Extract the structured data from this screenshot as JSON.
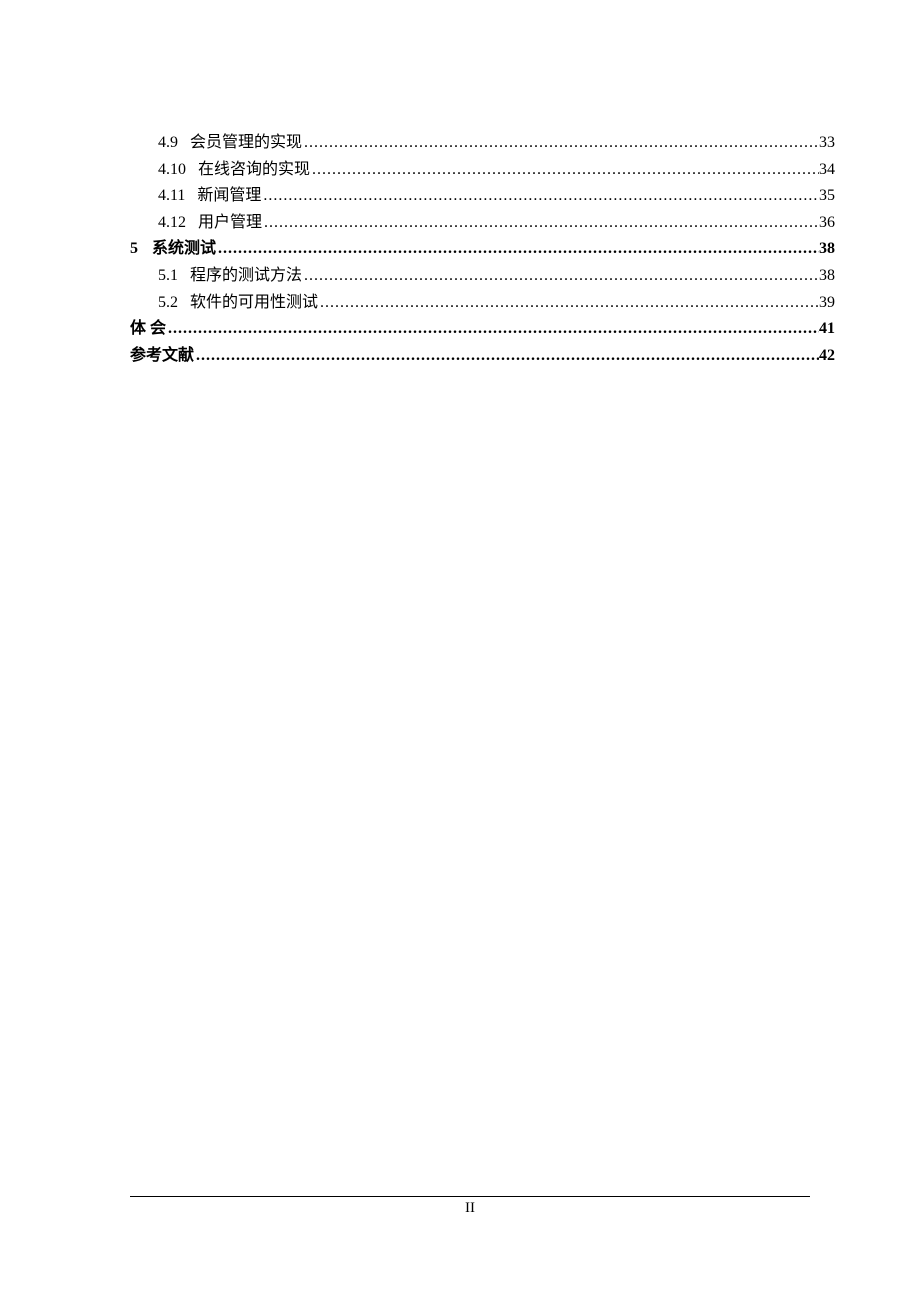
{
  "toc": {
    "items": [
      {
        "num": "4.9",
        "title": "会员管理的实现",
        "page": "33",
        "level": "sub",
        "bold": false
      },
      {
        "num": "4.10",
        "title": "在线咨询的实现",
        "page": "34",
        "level": "sub",
        "bold": false
      },
      {
        "num": "4.11",
        "title": "新闻管理",
        "page": "35",
        "level": "sub",
        "bold": false
      },
      {
        "num": "4.12",
        "title": "用户管理",
        "page": "36",
        "level": "sub",
        "bold": false
      },
      {
        "num": "5",
        "title": "系统测试 ",
        "page": "38",
        "level": "top",
        "bold": true
      },
      {
        "num": "5.1",
        "title": "程序的测试方法",
        "page": "38",
        "level": "sub",
        "bold": false
      },
      {
        "num": "5.2",
        "title": "软件的可用性测试",
        "page": "39",
        "level": "sub",
        "bold": false
      },
      {
        "num": "",
        "title": "体    会 ",
        "page": "41",
        "level": "top",
        "bold": true
      },
      {
        "num": "",
        "title": "参考文献 ",
        "page": "42",
        "level": "top",
        "bold": true
      }
    ]
  },
  "footer": {
    "page_number": "II"
  }
}
